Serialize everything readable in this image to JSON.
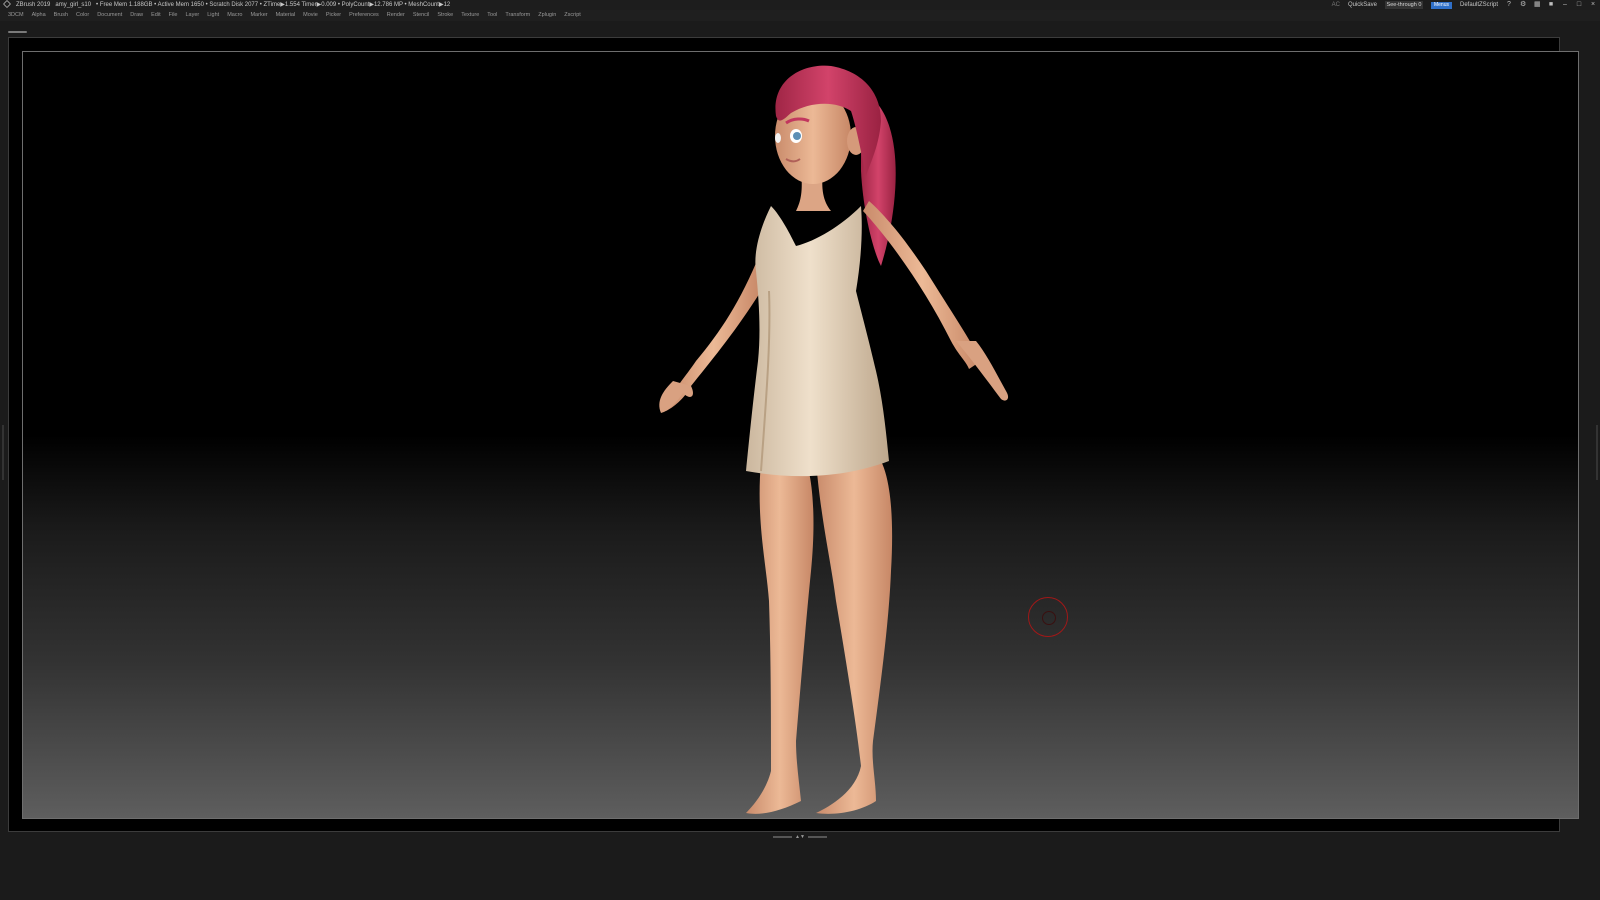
{
  "titlebar": {
    "app": "ZBrush 2019",
    "file": "amy_girl_s10",
    "stats": "• Free Mem 1.188GB • Active Mem 1650 • Scratch Disk 2077 • ZTime▶1.554 Timer▶0.009 • PolyCount▶12.786 MP • MeshCount▶12",
    "ac": "AC",
    "quicksave": "QuickSave",
    "see_through": "See-through  0",
    "see_through_level": 0,
    "menus_button": "Menus",
    "script": "DefaultZScript"
  },
  "menubar": {
    "items": [
      "3DCM",
      "Alpha",
      "Brush",
      "Color",
      "Document",
      "Draw",
      "Edit",
      "File",
      "Layer",
      "Light",
      "Macro",
      "Marker",
      "Material",
      "Movie",
      "Picker",
      "Preferences",
      "Render",
      "Stencil",
      "Stroke",
      "Texture",
      "Tool",
      "Transform",
      "Zplugin",
      "Zscript"
    ]
  },
  "icons": {
    "logo": "zbrush-logo-icon",
    "window_controls": [
      "help-icon",
      "palette-icon",
      "layout-icon",
      "lock-icon",
      "minimize-icon",
      "maximize-icon",
      "close-icon"
    ]
  },
  "colors": {
    "hair": "#c2375e",
    "skin": "#e7b391",
    "dress": "#ead9c2",
    "cursor": "#a01818"
  }
}
